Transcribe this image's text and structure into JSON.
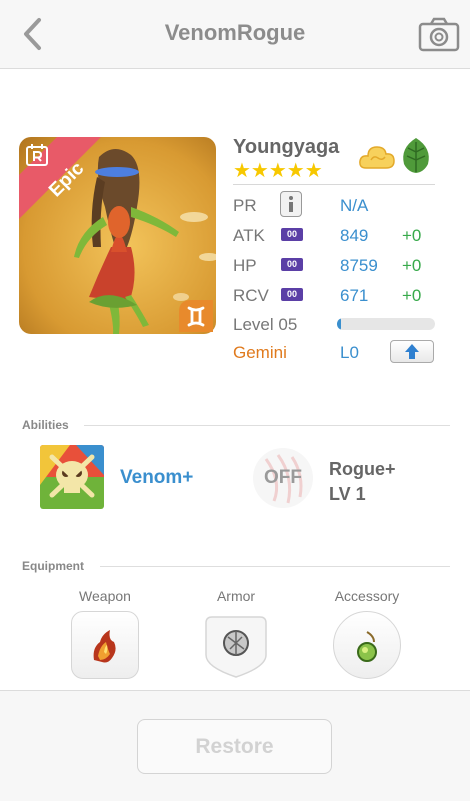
{
  "header": {
    "title": "VenomRogue",
    "back_icon": "chevron-left-icon",
    "camera_icon": "camera-icon"
  },
  "character": {
    "name": "Youngyaga",
    "rarity": "Epic",
    "stars": "★★★★★",
    "star_count": 5,
    "element_icon": "cloud-icon",
    "type_icon": "leaf-icon",
    "zodiac_icon": "gemini-icon"
  },
  "stats": {
    "pr": {
      "label": "PR",
      "value": "N/A"
    },
    "atk": {
      "label": "ATK",
      "badge": "00",
      "value": "849",
      "bonus": "+0"
    },
    "hp": {
      "label": "HP",
      "badge": "00",
      "value": "8759",
      "bonus": "+0"
    },
    "rcv": {
      "label": "RCV",
      "badge": "00",
      "value": "671",
      "bonus": "+0"
    },
    "level": {
      "label": "Level 05",
      "progress": 0.02
    },
    "zodiac": {
      "label": "Gemini",
      "value": "L0"
    }
  },
  "abilities": {
    "title": "Abilities",
    "active": {
      "label": "Venom+"
    },
    "passive": {
      "state": "OFF",
      "name": "Rogue+",
      "level": "LV 1"
    }
  },
  "equipment": {
    "title": "Equipment",
    "slots": [
      {
        "label": "Weapon"
      },
      {
        "label": "Armor"
      },
      {
        "label": "Accessory"
      }
    ]
  },
  "footer": {
    "restore_label": "Restore"
  },
  "colors": {
    "accent_blue": "#3a8fce",
    "bonus_green": "#37a94a",
    "gemini_orange": "#e07a1d",
    "epic_red": "#e85a68",
    "star_yellow": "#f7c800"
  }
}
